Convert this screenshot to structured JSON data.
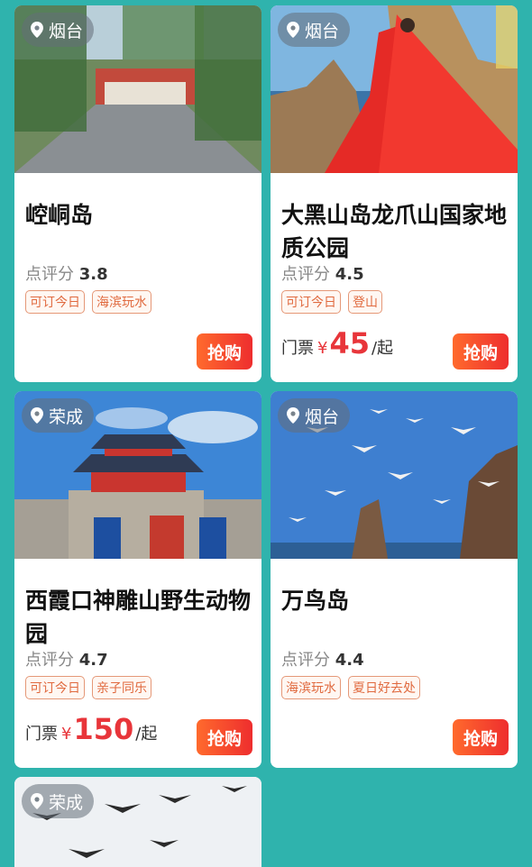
{
  "cards": [
    {
      "location": "烟台",
      "title": "崆峒岛",
      "rating_label": "点评分",
      "rating": "3.8",
      "tags": [
        "可订今日",
        "海滨玩水"
      ],
      "buy_label": "抢购"
    },
    {
      "location": "烟台",
      "title": "大黑山岛龙爪山国家地质公园",
      "rating_label": "点评分",
      "rating": "4.5",
      "tags": [
        "可订今日",
        "登山"
      ],
      "price_prefix": "门票",
      "price_currency": "¥",
      "price_value": "45",
      "price_suffix": "/起",
      "buy_label": "抢购"
    },
    {
      "location": "荣成",
      "title": "西霞口神雕山野生动物园",
      "rating_label": "点评分",
      "rating": "4.7",
      "tags": [
        "可订今日",
        "亲子同乐"
      ],
      "price_prefix": "门票",
      "price_currency": "¥",
      "price_value": "150",
      "price_suffix": "/起",
      "buy_label": "抢购"
    },
    {
      "location": "烟台",
      "title": "万鸟岛",
      "rating_label": "点评分",
      "rating": "4.4",
      "tags": [
        "海滨玩水",
        "夏日好去处"
      ],
      "buy_label": "抢购"
    },
    {
      "location": "荣成"
    }
  ],
  "colors": {
    "background": "#2fb3ad",
    "price": "#e8353a",
    "buy_button": "#f0452d",
    "tag_border": "#e59878"
  }
}
